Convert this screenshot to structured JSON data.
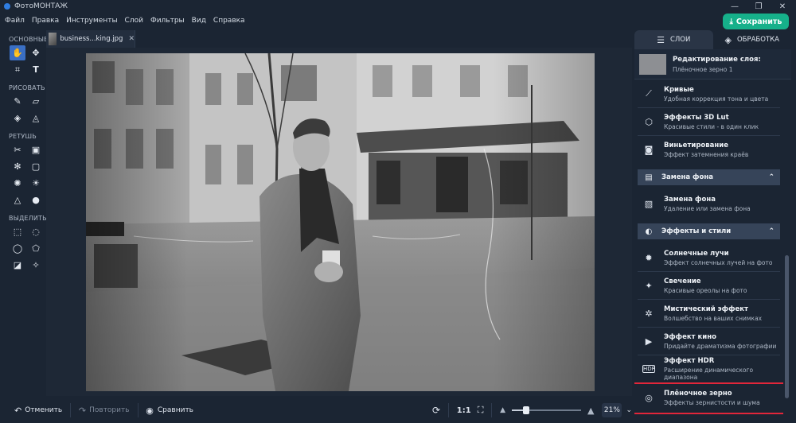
{
  "titlebar": {
    "app_title": "ФотоМОНТАЖ",
    "minimize": "—",
    "maximize": "❐",
    "close": "✕"
  },
  "menu": [
    "Файл",
    "Правка",
    "Инструменты",
    "Слой",
    "Фильтры",
    "Вид",
    "Справка"
  ],
  "save_button": {
    "label": "Сохранить",
    "color": "#16b08a"
  },
  "left_toolbar": {
    "groups": [
      {
        "label": "ОСНОВНЫЕ"
      },
      {
        "label": "РИСОВАТЬ"
      },
      {
        "label": "РЕТУШЬ"
      },
      {
        "label": "ВЫДЕЛИТЬ"
      }
    ]
  },
  "file_tab": {
    "name": "business...king.jpg",
    "close": "✕"
  },
  "bottom_bar": {
    "undo": "Отменить",
    "redo": "Повторить",
    "compare": "Сравнить",
    "ratio": "1:1",
    "zoom": "21%",
    "zoom_fraction": 0.21
  },
  "right_panel": {
    "tabs": [
      {
        "label": "СЛОИ",
        "icon": "sliders-icon"
      },
      {
        "label": "ОБРАБОТКА",
        "icon": "layers-icon"
      }
    ],
    "header": {
      "title": "Редактирование слоя:",
      "subtitle": "Плёночное зерно 1"
    },
    "items_top": [
      {
        "name": "Кривые",
        "desc": "Удобная коррекция тона и цвета",
        "icon": "curves-icon"
      },
      {
        "name": "Эффекты 3D Lut",
        "desc": "Красивые стили - в один клик",
        "icon": "cube-icon"
      },
      {
        "name": "Виньетирование",
        "desc": "Эффект затемнения краёв",
        "icon": "vignette-icon"
      }
    ],
    "section_bg": {
      "label": "Замена фона"
    },
    "items_bg": [
      {
        "name": "Замена фона",
        "desc": "Удаление или замена фона",
        "icon": "background-icon"
      }
    ],
    "section_fx": {
      "label": "Эффекты и стили"
    },
    "items_fx": [
      {
        "name": "Солнечные лучи",
        "desc": "Эффект солнечных лучей на фото",
        "icon": "sun-icon"
      },
      {
        "name": "Свечение",
        "desc": "Красивые ореолы на фото",
        "icon": "sparkle-icon"
      },
      {
        "name": "Мистический эффект",
        "desc": "Волшебство на ваших снимках",
        "icon": "mystic-icon"
      },
      {
        "name": "Эффект кино",
        "desc": "Придайте драматизма фотографии",
        "icon": "camera-icon"
      },
      {
        "name": "Эффект HDR",
        "desc": "Расширение динамического диапазона",
        "icon": "hdr-icon"
      },
      {
        "name": "Плёночное зерно",
        "desc": "Эффекты зернистости и шума",
        "icon": "grain-icon"
      }
    ],
    "highlight_color": "#e2263a"
  }
}
